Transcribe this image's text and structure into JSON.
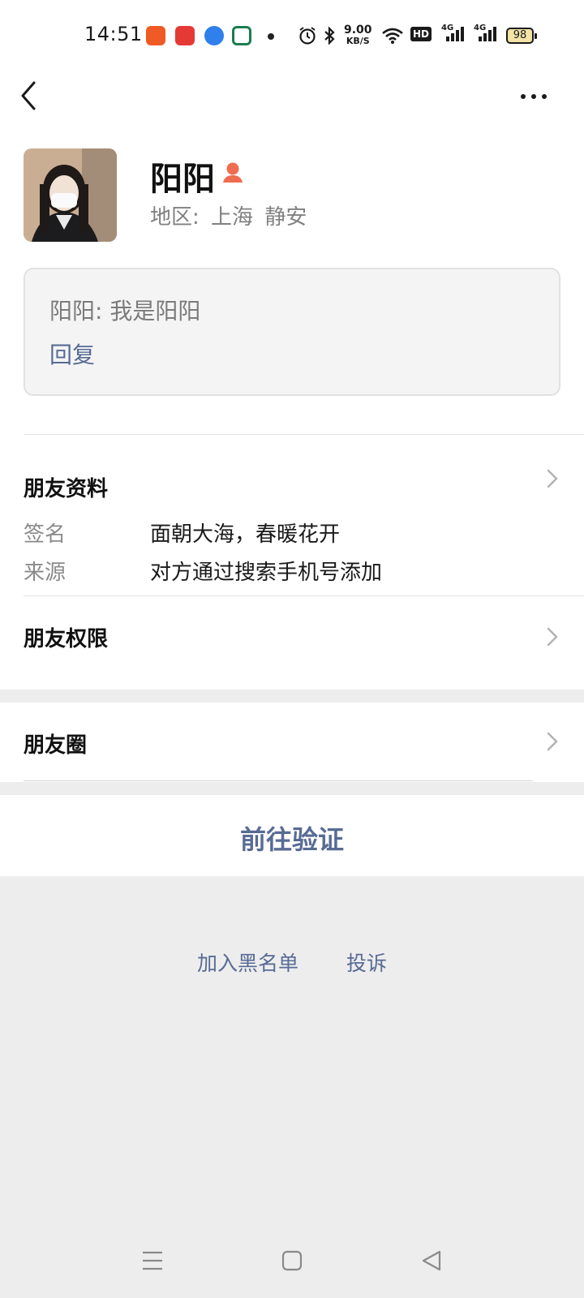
{
  "status_bar": {
    "time": "14:51",
    "speed_value": "9.00",
    "speed_unit": "KB/S",
    "hd_label": "HD",
    "signal1_label": "4G",
    "signal2_label": "4G",
    "battery": "98"
  },
  "profile": {
    "name": "阳阳",
    "region_label": "地区:",
    "region_city": "上海",
    "region_district": "静安"
  },
  "message": {
    "text": "阳阳: 我是阳阳",
    "reply_label": "回复"
  },
  "friend_info": {
    "title": "朋友资料",
    "rows": [
      {
        "label": "签名",
        "value": "面朝大海，春暖花开"
      },
      {
        "label": "来源",
        "value": "对方通过搜索手机号添加"
      }
    ]
  },
  "permissions": {
    "title": "朋友权限"
  },
  "moments": {
    "title": "朋友圈"
  },
  "verify_button": "前往验证",
  "bottom_links": {
    "blacklist": "加入黑名单",
    "complain": "投诉"
  },
  "colors": {
    "link": "#576b95",
    "gender_icon": "#f06c4f"
  }
}
